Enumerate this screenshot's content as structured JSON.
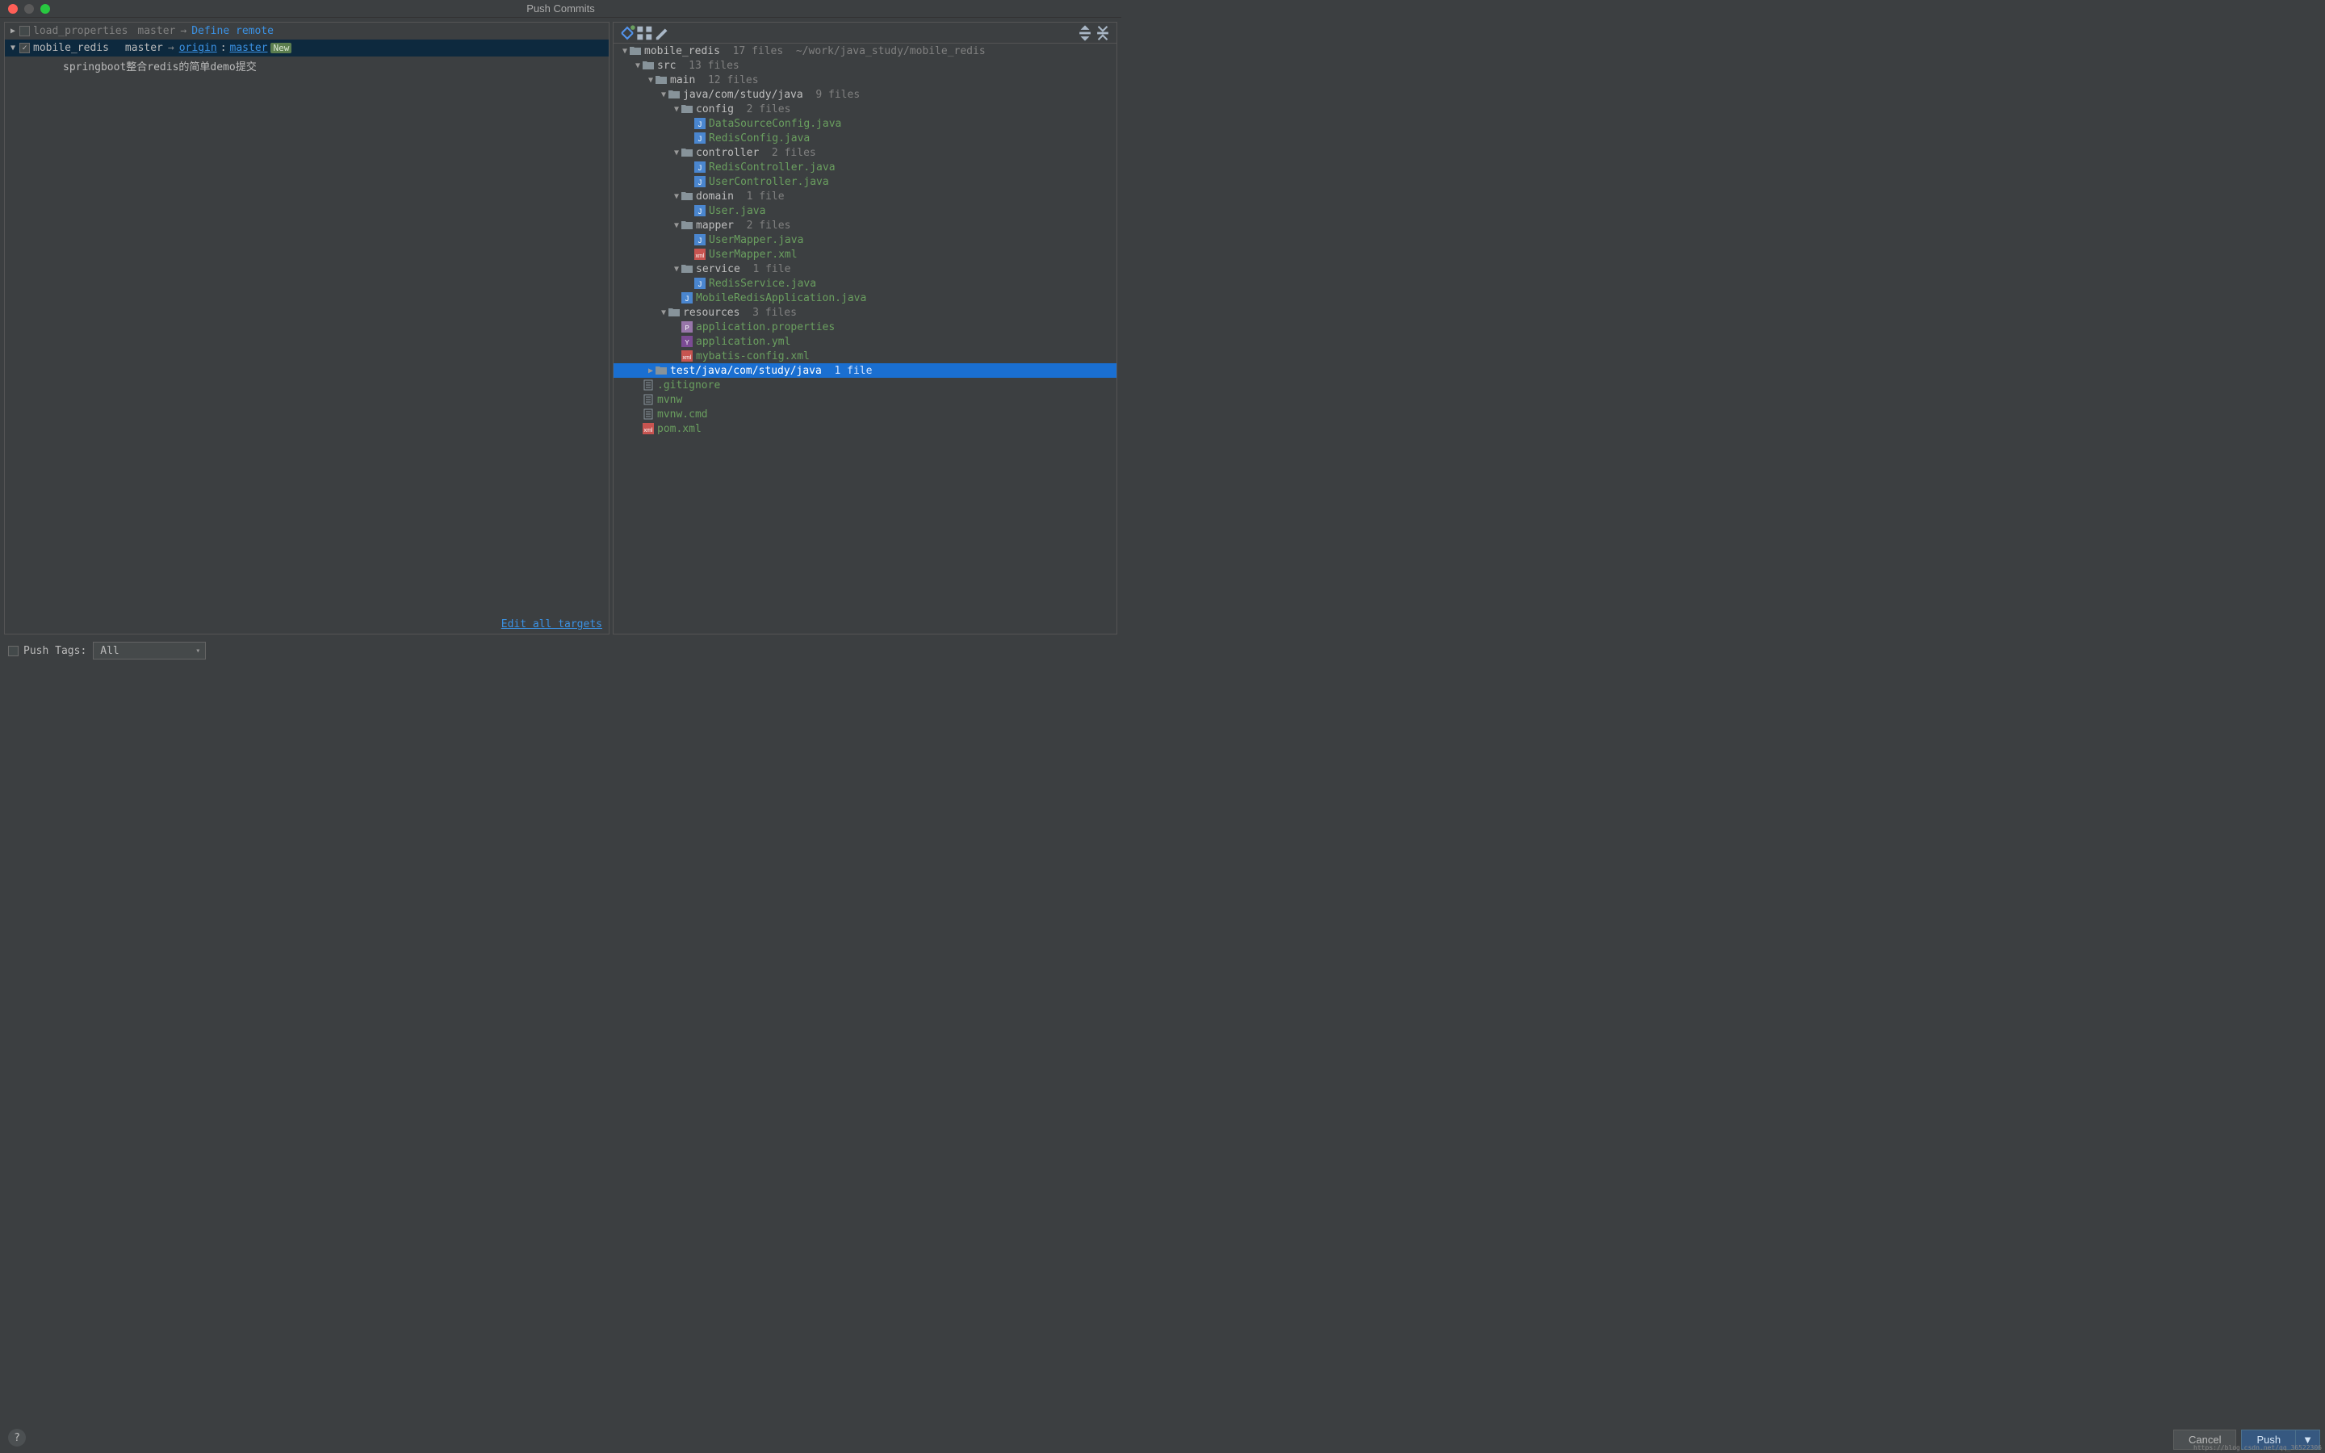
{
  "title": "Push Commits",
  "left": {
    "repos": [
      {
        "expanded": false,
        "checked": false,
        "name": "load_properties",
        "local": "master",
        "remote": "Define remote",
        "has_remote": false
      },
      {
        "expanded": true,
        "checked": true,
        "selected": true,
        "name": "mobile_redis",
        "local": "master",
        "remote_origin": "origin",
        "remote_branch": "master",
        "has_remote": true,
        "new_label": "New",
        "commits": [
          "springboot整合redis的简单demo提交"
        ]
      }
    ],
    "edit_all": "Edit all targets",
    "push_tags_label": "Push Tags:",
    "push_tags_value": "All"
  },
  "tree": [
    {
      "d": 0,
      "e": "▼",
      "type": "root",
      "name": "mobile_redis",
      "count": "17 files",
      "path": "~/work/java_study/mobile_redis"
    },
    {
      "d": 1,
      "e": "▼",
      "type": "dir",
      "name": "src",
      "count": "13 files"
    },
    {
      "d": 2,
      "e": "▼",
      "type": "dir",
      "name": "main",
      "count": "12 files"
    },
    {
      "d": 3,
      "e": "▼",
      "type": "dir",
      "name": "java/com/study/java",
      "count": "9 files"
    },
    {
      "d": 4,
      "e": "▼",
      "type": "dir",
      "name": "config",
      "count": "2 files"
    },
    {
      "d": 5,
      "e": "",
      "type": "java",
      "name": "DataSourceConfig.java"
    },
    {
      "d": 5,
      "e": "",
      "type": "java",
      "name": "RedisConfig.java"
    },
    {
      "d": 4,
      "e": "▼",
      "type": "dir",
      "name": "controller",
      "count": "2 files"
    },
    {
      "d": 5,
      "e": "",
      "type": "java",
      "name": "RedisController.java"
    },
    {
      "d": 5,
      "e": "",
      "type": "java",
      "name": "UserController.java"
    },
    {
      "d": 4,
      "e": "▼",
      "type": "dir",
      "name": "domain",
      "count": "1 file"
    },
    {
      "d": 5,
      "e": "",
      "type": "java",
      "name": "User.java"
    },
    {
      "d": 4,
      "e": "▼",
      "type": "dir",
      "name": "mapper",
      "count": "2 files"
    },
    {
      "d": 5,
      "e": "",
      "type": "java",
      "name": "UserMapper.java"
    },
    {
      "d": 5,
      "e": "",
      "type": "xml",
      "name": "UserMapper.xml"
    },
    {
      "d": 4,
      "e": "▼",
      "type": "dir",
      "name": "service",
      "count": "1 file"
    },
    {
      "d": 5,
      "e": "",
      "type": "java",
      "name": "RedisService.java"
    },
    {
      "d": 4,
      "e": "",
      "type": "java",
      "name": "MobileRedisApplication.java"
    },
    {
      "d": 3,
      "e": "▼",
      "type": "dir",
      "name": "resources",
      "count": "3 files"
    },
    {
      "d": 4,
      "e": "",
      "type": "prop",
      "name": "application.properties"
    },
    {
      "d": 4,
      "e": "",
      "type": "yml",
      "name": "application.yml"
    },
    {
      "d": 4,
      "e": "",
      "type": "xml",
      "name": "mybatis-config.xml"
    },
    {
      "d": 2,
      "e": "▶",
      "type": "dir",
      "name": "test/java/com/study/java",
      "count": "1 file",
      "selected": true
    },
    {
      "d": 1,
      "e": "",
      "type": "txt",
      "name": ".gitignore"
    },
    {
      "d": 1,
      "e": "",
      "type": "txt",
      "name": "mvnw"
    },
    {
      "d": 1,
      "e": "",
      "type": "txt",
      "name": "mvnw.cmd"
    },
    {
      "d": 1,
      "e": "",
      "type": "xml",
      "name": "pom.xml"
    }
  ],
  "buttons": {
    "cancel": "Cancel",
    "push": "Push"
  },
  "watermark": "https://blog.csdn.net/qq_36522306"
}
